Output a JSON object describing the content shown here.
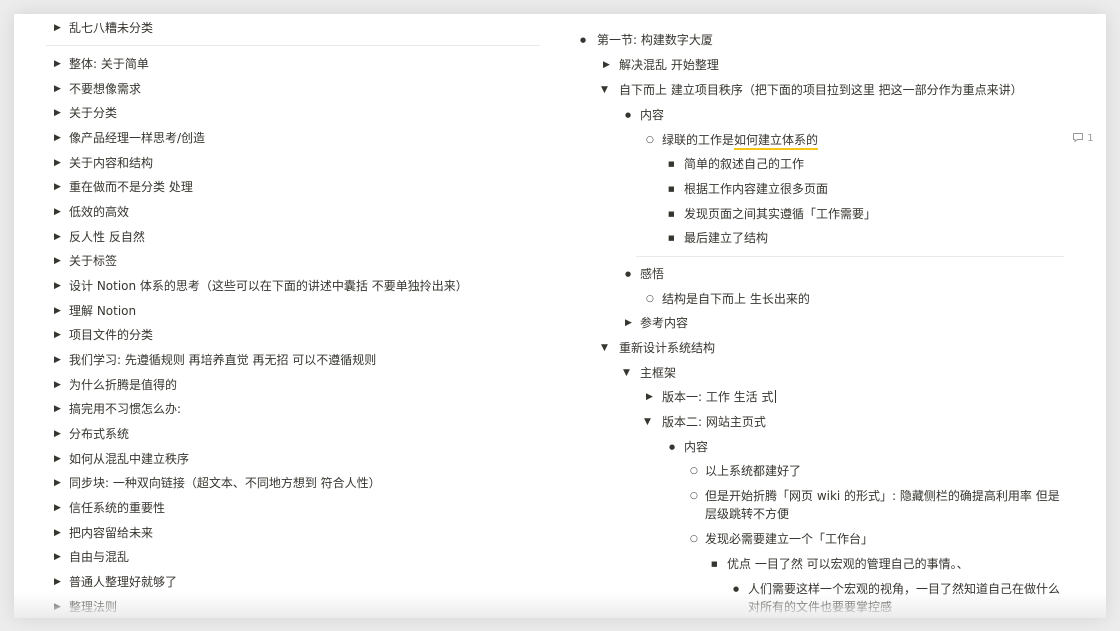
{
  "toggle_icon": "▶",
  "expanded_icon": "▼",
  "bullet_disc": "●",
  "bullet_circle": "○",
  "bullet_square": "■",
  "comment_count": "1",
  "left_column": {
    "first_item": "乱七八糟未分类",
    "items": [
      "整体: 关于简单",
      "不要想像需求",
      "关于分类",
      "像产品经理一样思考/创造",
      "关于内容和结构",
      "重在做而不是分类 处理",
      "低效的高效",
      "反人性 反自然",
      "关于标签",
      "设计 Notion 体系的思考（这些可以在下面的讲述中囊括 不要单独拎出来）",
      "理解 Notion",
      "项目文件的分类",
      "我们学习: 先遵循规则 再培养直觉 再无招 可以不遵循规则",
      "为什么折腾是值得的",
      "搞完用不习惯怎么办:",
      "分布式系统",
      "如何从混乱中建立秩序",
      "同步块: 一种双向链接（超文本、不同地方想到 符合人性）",
      "信任系统的重要性",
      "把内容留给未来",
      "自由与混乱",
      "普通人整理好就够了",
      "整理法则"
    ]
  },
  "right_column": {
    "section1": "第一节: 构建数字大厦",
    "solve": "解决混乱 开始整理",
    "bottom_up": "自下而上 建立项目秩序（把下面的项目拉到这里 把这一部分作为重点来讲）",
    "content1": "内容",
    "work_prefix": "绿联的工作是",
    "work_highlight": "如何建立体系的",
    "sub_items": [
      "简单的叙述自己的工作",
      "根据工作内容建立很多页面",
      "发现页面之间其实遵循「工作需要」",
      "最后建立了结构"
    ],
    "insight": "感悟",
    "insight_item": "结构是自下而上 生长出来的",
    "reference": "参考内容",
    "redesign": "重新设计系统结构",
    "main_frame": "主框架",
    "v1": "版本一: 工作 生活 式",
    "v2": "版本二: 网站主页式",
    "content2": "内容",
    "v2_items": [
      "以上系统都建好了",
      "但是开始折腾「网页 wiki 的形式」:  隐藏侧栏的确提高利用率 但是层级跳转不方便",
      "发现必需要建立一个「工作台」"
    ],
    "advantage": "优点 一目了然 可以宏观的管理自己的事情。、",
    "advantage_detail": "人们需要这样一个宏观的视角，一目了然知道自己在做什么 对所有的文件也要要掌控感"
  }
}
